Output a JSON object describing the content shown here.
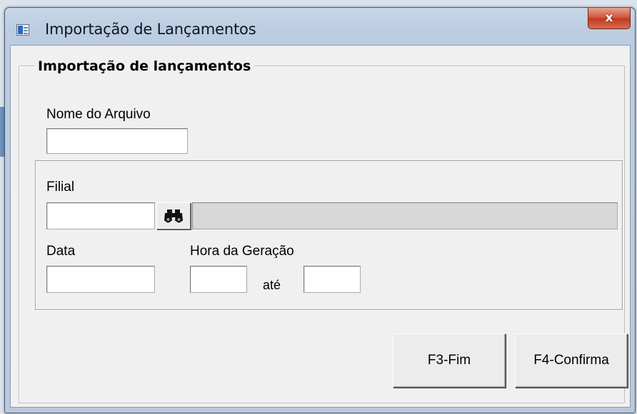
{
  "window": {
    "title": "Importação de Lançamentos",
    "close_label": "x"
  },
  "group": {
    "title": "Importação de lançamentos"
  },
  "form": {
    "nome_arquivo_label": "Nome do Arquivo",
    "nome_arquivo_value": "",
    "filial_label": "Filial",
    "filial_value": "",
    "filial_description": "",
    "data_label": "Data",
    "data_value": "",
    "hora_label": "Hora da Geração",
    "hora_inicio_value": "",
    "ate_label": "até",
    "hora_fim_value": ""
  },
  "buttons": {
    "fim_label": "F3-Fim",
    "confirma_label": "F4-Confirma"
  },
  "icons": {
    "app": "window-app-icon",
    "lookup": "binoculars-icon"
  }
}
